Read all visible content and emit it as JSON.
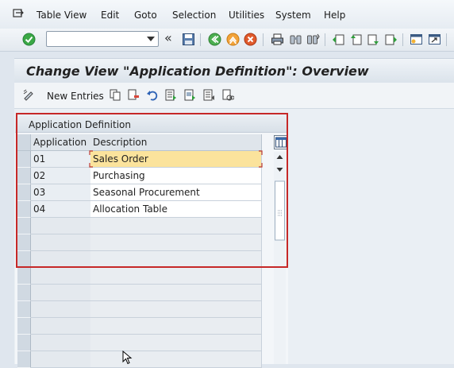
{
  "menubar": {
    "items": [
      "Table View",
      "Edit",
      "Goto",
      "Selection",
      "Utilities",
      "System",
      "Help"
    ]
  },
  "toolbar": {
    "command_field_value": "",
    "icons": [
      "enter-check-icon",
      "back-double-icon",
      "save-icon",
      "back-icon",
      "exit-icon",
      "cancel-icon",
      "print-icon",
      "find-icon",
      "find-next-icon",
      "first-page-icon",
      "previous-page-icon",
      "next-page-icon",
      "last-page-icon",
      "new-session-icon",
      "shortcut-icon"
    ]
  },
  "page": {
    "title": "Change View \"Application Definition\": Overview"
  },
  "app_toolbar": {
    "new_entries_label": "New Entries"
  },
  "table": {
    "title": "Application Definition",
    "columns": [
      "Application",
      "Description"
    ],
    "rows": [
      {
        "application": "01",
        "description": "Sales Order"
      },
      {
        "application": "02",
        "description": "Purchasing"
      },
      {
        "application": "03",
        "description": "Seasonal Procurement"
      },
      {
        "application": "04",
        "description": "Allocation Table"
      }
    ]
  },
  "colors": {
    "highlight": "#c62828",
    "focus_cell": "#fbe39c",
    "accent_green": "#2e9e3a"
  }
}
